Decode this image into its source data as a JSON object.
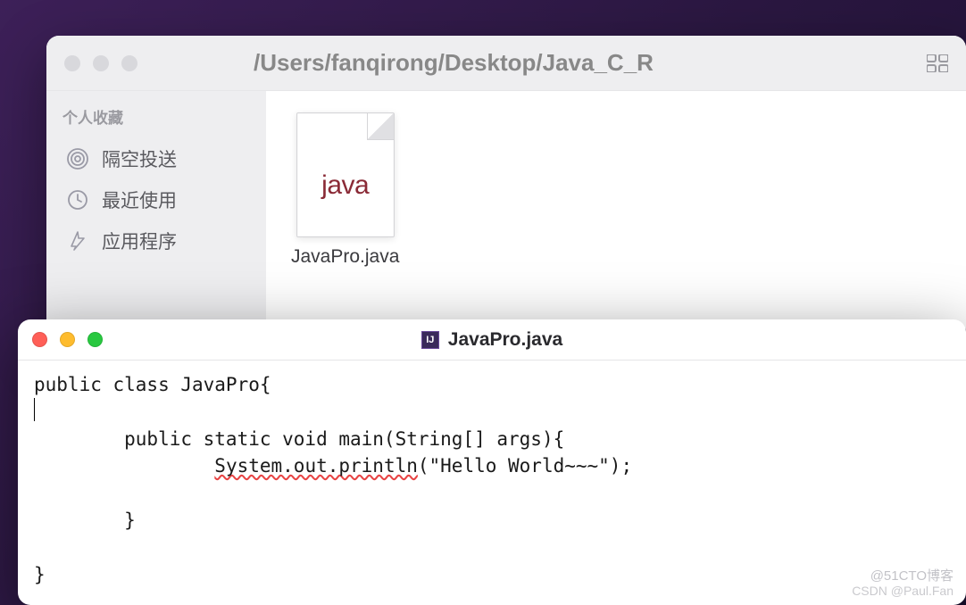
{
  "finder": {
    "path": "/Users/fanqirong/Desktop/Java_C_R",
    "sidebar": {
      "heading": "个人收藏",
      "items": [
        {
          "icon": "airdrop-icon",
          "label": "隔空投送"
        },
        {
          "icon": "clock-icon",
          "label": "最近使用"
        },
        {
          "icon": "apps-icon",
          "label": "应用程序"
        }
      ]
    },
    "files": [
      {
        "ext": "java",
        "name": "JavaPro.java"
      }
    ]
  },
  "editor": {
    "app_glyph": "IJ",
    "filename": "JavaPro.java",
    "code_lines": [
      "public class JavaPro{",
      "",
      "        public static void main(String[] args){",
      "                System.out.println(\"Hello World~~~\");",
      "",
      "        }",
      "",
      "}"
    ],
    "spell_segment": "System.out.println"
  },
  "watermarks": {
    "w1": "@51CTO博客",
    "w2": "CSDN @Paul.Fan"
  }
}
